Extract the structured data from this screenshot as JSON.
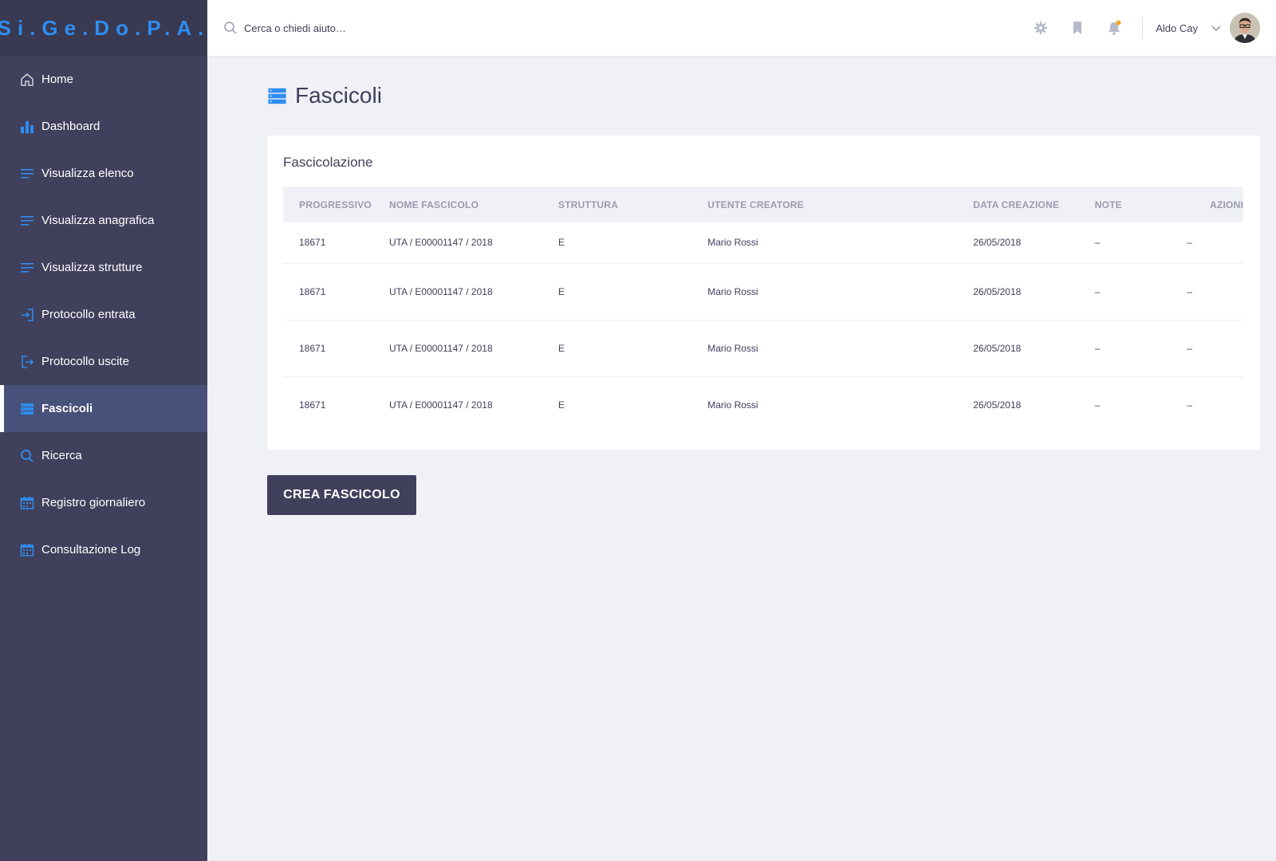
{
  "brand": {
    "logo_text": "Si.Ge.Do.P.A."
  },
  "sidebar": {
    "items": [
      {
        "label": "Home",
        "icon": "home-icon"
      },
      {
        "label": "Dashboard",
        "icon": "bar-chart-icon"
      },
      {
        "label": "Visualizza elenco",
        "icon": "list-icon"
      },
      {
        "label": "Visualizza anagrafica",
        "icon": "list-icon"
      },
      {
        "label": "Visualizza strutture",
        "icon": "list-icon"
      },
      {
        "label": "Protocollo entrata",
        "icon": "login-icon"
      },
      {
        "label": "Protocollo uscite",
        "icon": "logout-icon"
      },
      {
        "label": "Fascicoli",
        "icon": "stack-icon",
        "active": true
      },
      {
        "label": "Ricerca",
        "icon": "search-icon"
      },
      {
        "label": "Registro giornaliero",
        "icon": "calendar-icon"
      },
      {
        "label": "Consultazione Log",
        "icon": "calendar-icon"
      }
    ]
  },
  "topbar": {
    "search_placeholder": "Cerca o chiedi aiuto…",
    "user_name": "Aldo Cay",
    "icons": [
      "gear-icon",
      "bookmark-icon",
      "bell-icon",
      "chevron-down-icon"
    ],
    "notification_dot_color": "#f5a623"
  },
  "page": {
    "title": "Fascicoli",
    "card_title": "Fascicolazione",
    "table": {
      "columns": [
        "PROGRESSIVO",
        "NOME FASCICOLO",
        "STRUTTURA",
        "UTENTE CREATORE",
        "DATA CREAZIONE",
        "NOTE",
        "AZIONI"
      ],
      "rows": [
        [
          "18671",
          "UTA / E00001147 / 2018",
          "E",
          "Mario Rossi",
          "26/05/2018",
          "–",
          "–"
        ],
        [
          "18671",
          "UTA / E00001147 / 2018",
          "E",
          "Mario Rossi",
          "26/05/2018",
          "–",
          "–"
        ],
        [
          "18671",
          "UTA / E00001147 / 2018",
          "E",
          "Mario Rossi",
          "26/05/2018",
          "–",
          "–"
        ],
        [
          "18671",
          "UTA / E00001147 / 2018",
          "E",
          "Mario Rossi",
          "26/05/2018",
          "–",
          "–"
        ]
      ]
    },
    "create_button_label": "CREA FASCICOLO"
  },
  "colors": {
    "sidebar_bg": "#40405c",
    "accent": "#2d8df0",
    "background": "#f0f1f6"
  }
}
